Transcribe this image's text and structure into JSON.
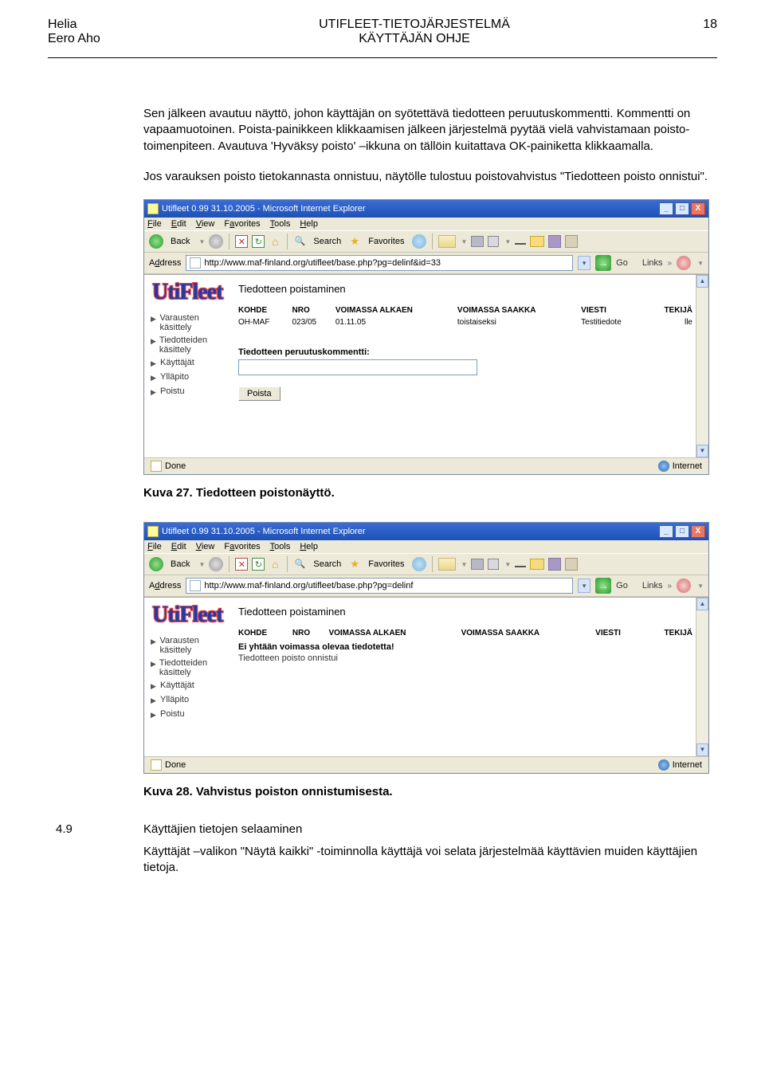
{
  "header": {
    "org": "Helia",
    "author": "Eero Aho",
    "title1": "UTIFLEET-TIETOJÄRJESTELMÄ",
    "title2": "KÄYTTÄJÄN OHJE",
    "page": "18"
  },
  "paragraphs": {
    "p1": "Sen jälkeen avautuu näyttö, johon käyttäjän on syötettävä tiedotteen peruutuskommentti. Kommentti on vapaamuotoinen. Poista-painikkeen klikkaamisen jälkeen järjestelmä pyytää vielä vahvistamaan poisto-toimenpiteen. Avautuva 'Hyväksy poisto' –ikkuna on tällöin kuitattava OK-painiketta klikkaamalla.",
    "p2": "Jos varauksen poisto tietokannasta onnistuu, näytölle tulostuu poistovahvistus \"Tiedotteen poisto onnistui\"."
  },
  "captions": {
    "c1": "Kuva 27. Tiedotteen poistonäyttö.",
    "c2": "Kuva 28. Vahvistus poiston onnistumisesta."
  },
  "section": {
    "num": "4.9",
    "title": "Käyttäjien tietojen selaaminen",
    "body": "Käyttäjät –valikon \"Näytä kaikki\" -toiminnolla käyttäjä voi selata järjestelmää käyttävien muiden käyttäjien tietoja."
  },
  "ie": {
    "title_a": "Utifleet 0.99 31.10.2005 - Microsoft Internet Explorer",
    "title_b": "Utifleet 0.99 31.10.2005 - Microsoft Internet Explorer",
    "menu": {
      "file": "File",
      "edit": "Edit",
      "view": "View",
      "favorites": "Favorites",
      "tools": "Tools",
      "help": "Help"
    },
    "toolbar": {
      "back": "Back",
      "search": "Search",
      "favorites": "Favorites"
    },
    "addr": {
      "label": "Address",
      "url_a": "http://www.maf-finland.org/utifleet/base.php?pg=delinf&id=33",
      "url_b": "http://www.maf-finland.org/utifleet/base.php?pg=delinf",
      "go": "Go",
      "links": "Links"
    },
    "logo": "UtiFleet",
    "nav": [
      "Varausten käsittely",
      "Tiedotteiden käsittely",
      "Käyttäjät",
      "Ylläpito",
      "Poistu"
    ],
    "page_title": "Tiedotteen poistaminen",
    "headers": {
      "kohde": "KOHDE",
      "nro": "NRO",
      "va": "VOIMASSA ALKAEN",
      "vs": "VOIMASSA SAAKKA",
      "viesti": "VIESTI",
      "tekija": "TEKIJÄ"
    },
    "row": {
      "kohde": "OH-MAF",
      "nro": "023/05",
      "va": "01.11.05",
      "vs": "toistaiseksi",
      "viesti": "Testitiedote",
      "tekija": "lle"
    },
    "form": {
      "label": "Tiedotteen peruutuskommentti:",
      "button": "Poista"
    },
    "result": {
      "none": "Ei yhtään voimassa olevaa tiedotetta!",
      "ok": "Tiedotteen poisto onnistui"
    },
    "status": {
      "done": "Done",
      "zone": "Internet"
    }
  }
}
